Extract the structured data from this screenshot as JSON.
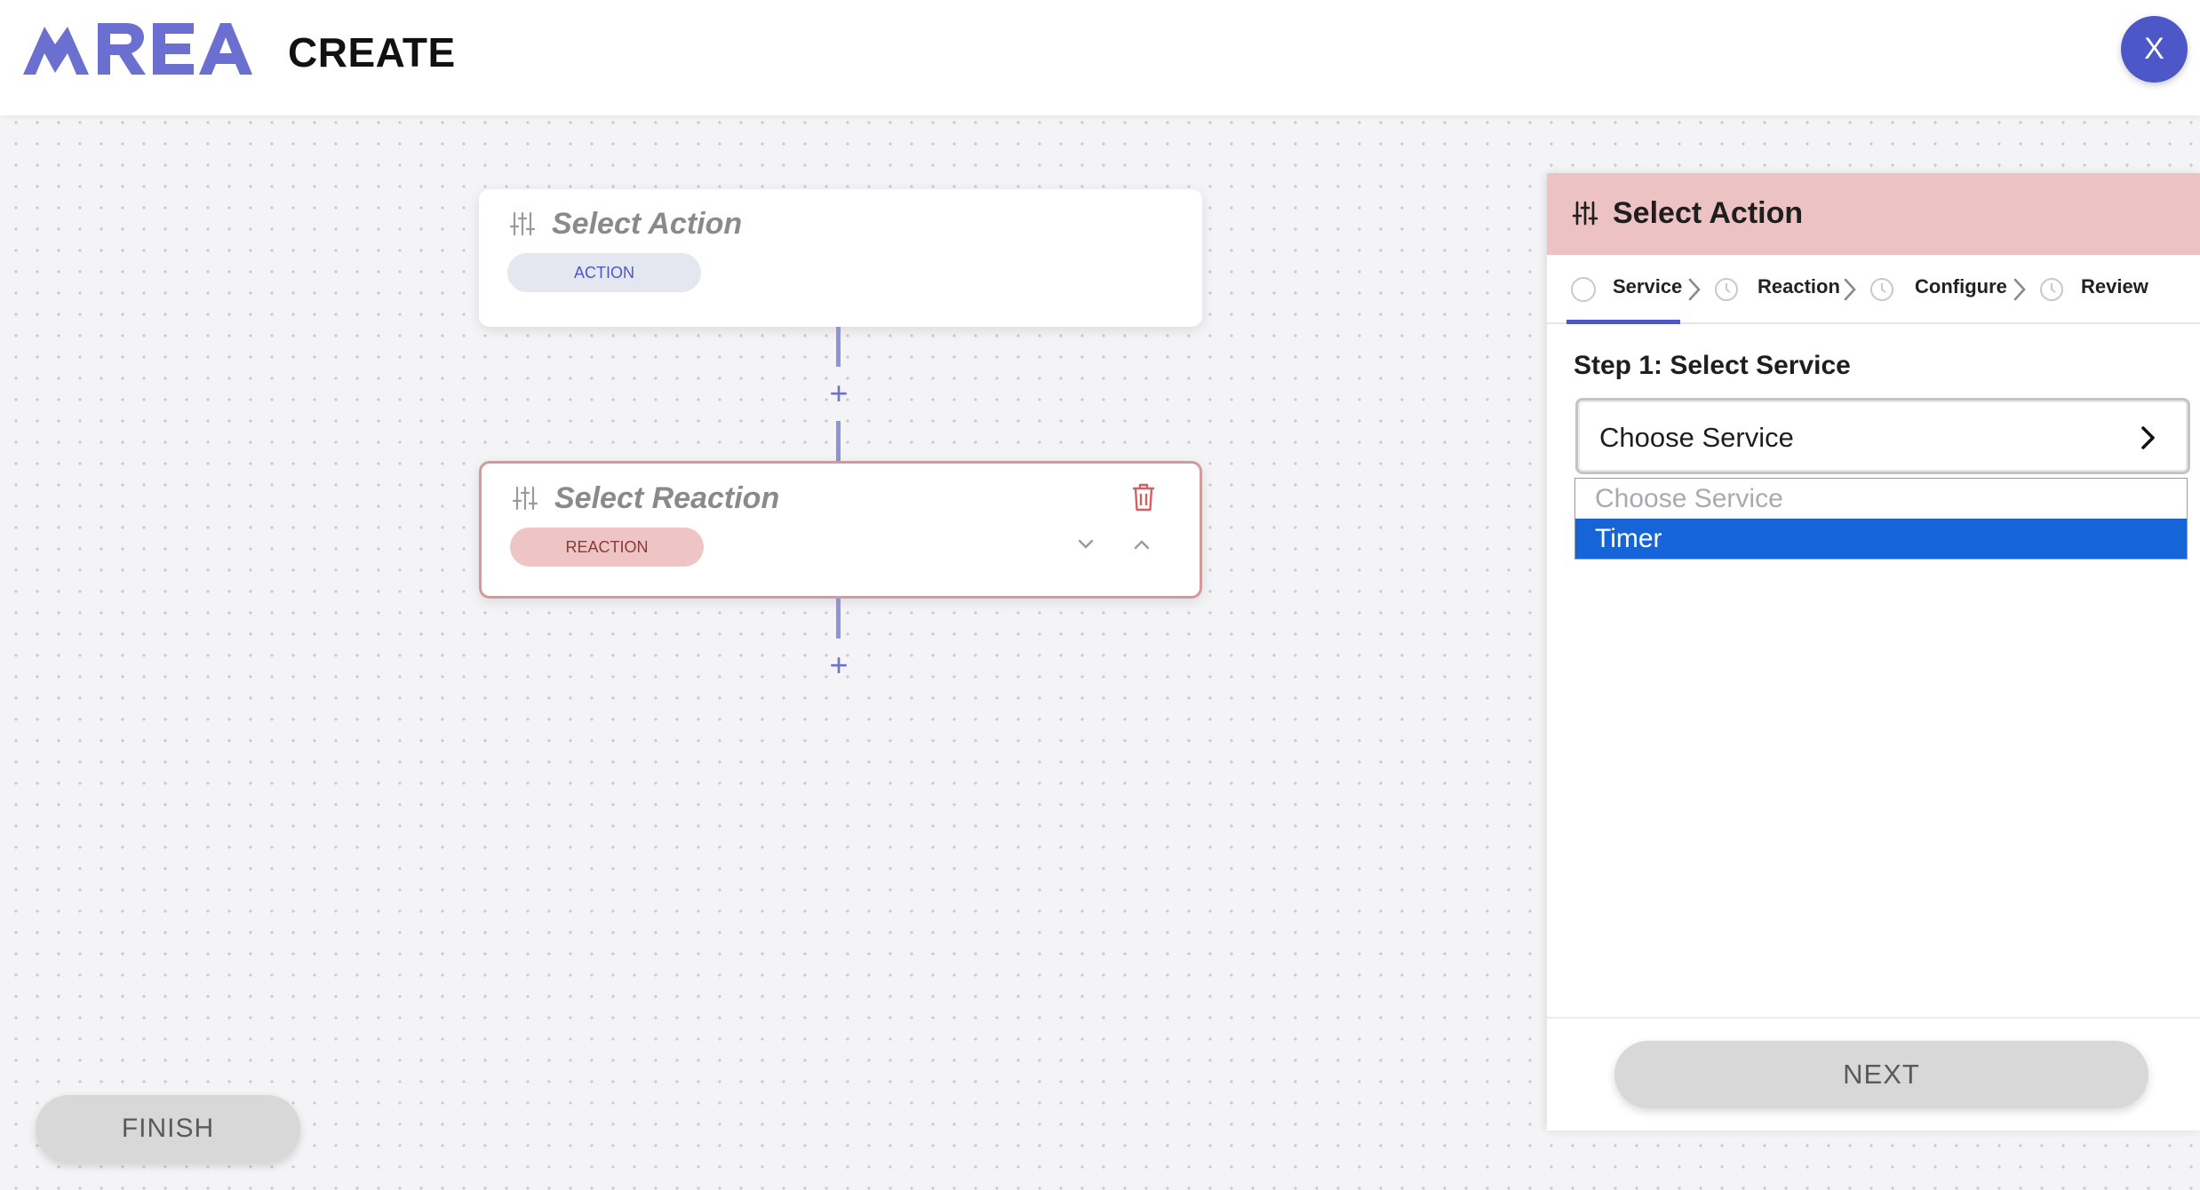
{
  "header": {
    "logo_text": "AREA",
    "page_title": "CREATE",
    "close_label": "X"
  },
  "flow": {
    "action_card": {
      "title": "Select Action",
      "chip": "ACTION"
    },
    "reaction_card": {
      "title": "Select Reaction",
      "chip": "REACTION"
    },
    "add_symbol": "+"
  },
  "finish_label": "FINISH",
  "panel": {
    "title": "Select Action",
    "steps": [
      {
        "label": "Service",
        "active": true
      },
      {
        "label": "Reaction",
        "active": false
      },
      {
        "label": "Configure",
        "active": false
      },
      {
        "label": "Review",
        "active": false
      }
    ],
    "heading": "Step 1: Select Service",
    "select_value": "Choose Service",
    "options": [
      "Choose Service",
      "Timer"
    ],
    "selected_option": "Timer",
    "next_label": "NEXT"
  },
  "colors": {
    "brand": "#4e57c7",
    "reaction_accent": "#ecc2c2",
    "selected_option": "#1565d8"
  }
}
